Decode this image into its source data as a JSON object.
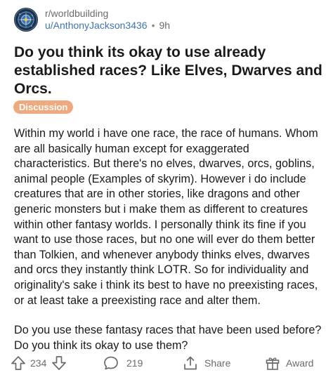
{
  "post": {
    "subreddit": "r/worldbuilding",
    "author": "u/AnthonyJackson3436",
    "separator": "•",
    "age": "9h",
    "title": "Do you think its okay to use already established races? Like Elves, Dwarves and Orcs.",
    "flair": "Discussion",
    "body": [
      "Within my world i have one race, the race of humans. Whom are all basically human except for exaggerated characteristics. But there's no elves, dwarves, orcs, goblins, animal people (Examples of skyrim). However i do include creatures that are in other stories, like dragons and other generic monsters but i make them as different to creatures within other fantasy worlds. I personally think its fine if you want to use those races, but no one will ever do them better than Tolkien, and whenever anybody thinks elves, dwarves and orcs they instantly think LOTR. So for individuality and originality's sake i think its best to have no preexisting races, or at least take a preexisting race and alter them.",
      "Do you use these fantasy races that have been used before? Do you think its okay to use them?"
    ]
  },
  "actions": {
    "votes": "234",
    "comments": "219",
    "share_label": "Share",
    "award_label": "Award"
  },
  "colors": {
    "flair_bg": "#f0a87d",
    "username": "#3d74b8",
    "meta_text": "#6b6b6b",
    "icon": "#6b6b6b"
  },
  "icons": {
    "avatar": "subreddit-avatar-icon",
    "upvote": "upvote-arrow-icon",
    "downvote": "downvote-arrow-icon",
    "comments": "comment-bubble-icon",
    "share": "share-icon",
    "award": "award-gift-icon"
  }
}
